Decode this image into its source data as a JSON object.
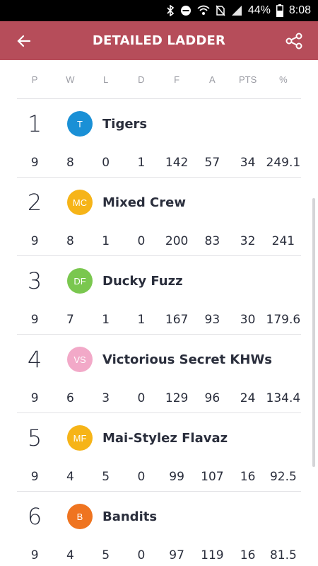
{
  "status": {
    "battery": "44%",
    "time": "8:08"
  },
  "app_bar": {
    "title": "DETAILED LADDER"
  },
  "headers": [
    "P",
    "W",
    "L",
    "D",
    "F",
    "A",
    "PTS",
    "%"
  ],
  "teams": [
    {
      "rank": "1",
      "initials": "T",
      "color": "#1a90d6",
      "name": "Tigers",
      "stats": [
        "9",
        "8",
        "0",
        "1",
        "142",
        "57",
        "34",
        "249.1"
      ]
    },
    {
      "rank": "2",
      "initials": "MC",
      "color": "#f6b418",
      "name": "Mixed Crew",
      "stats": [
        "9",
        "8",
        "1",
        "0",
        "200",
        "83",
        "32",
        "241"
      ]
    },
    {
      "rank": "3",
      "initials": "DF",
      "color": "#7ac74f",
      "name": "Ducky Fuzz",
      "stats": [
        "9",
        "7",
        "1",
        "1",
        "167",
        "93",
        "30",
        "179.6"
      ]
    },
    {
      "rank": "4",
      "initials": "VS",
      "color": "#f2a9c8",
      "name": "Victorious Secret KHWs",
      "stats": [
        "9",
        "6",
        "3",
        "0",
        "129",
        "96",
        "24",
        "134.4"
      ]
    },
    {
      "rank": "5",
      "initials": "MF",
      "color": "#f6b418",
      "name": "Mai-Stylez Flavaz",
      "stats": [
        "9",
        "4",
        "5",
        "0",
        "99",
        "107",
        "16",
        "92.5"
      ]
    },
    {
      "rank": "6",
      "initials": "B",
      "color": "#ef7420",
      "name": "Bandits",
      "stats": [
        "9",
        "4",
        "5",
        "0",
        "97",
        "119",
        "16",
        "81.5"
      ]
    }
  ]
}
